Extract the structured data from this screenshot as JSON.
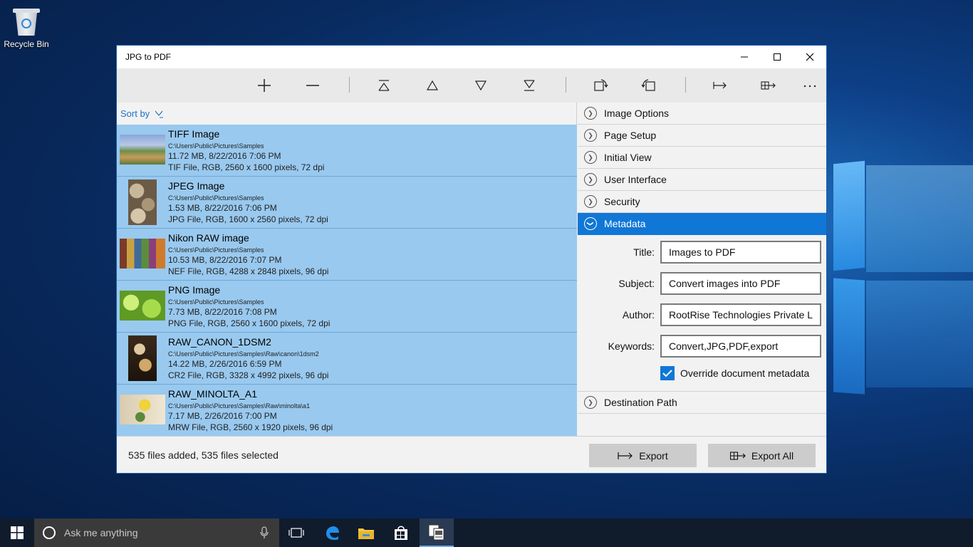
{
  "desktop": {
    "recycle_bin_label": "Recycle Bin"
  },
  "window": {
    "title": "JPG to PDF"
  },
  "toolbar": {
    "icons": [
      "add-icon",
      "remove-icon",
      "move-top-icon",
      "move-up-icon",
      "move-down-icon",
      "move-bottom-icon",
      "rotate-left-icon",
      "rotate-right-icon",
      "export-icon",
      "export-all-icon",
      "more-icon"
    ]
  },
  "sort": {
    "label": "Sort by"
  },
  "files": [
    {
      "name": "TIFF Image",
      "path": "C:\\Users\\Public\\Pictures\\Samples",
      "size": "11.72 MB, 8/22/2016 7:06 PM",
      "info": "TIF File, RGB, 2560 x 1600 pixels, 72 dpi"
    },
    {
      "name": "JPEG Image",
      "path": "C:\\Users\\Public\\Pictures\\Samples",
      "size": "1.53 MB, 8/22/2016 7:06 PM",
      "info": "JPG File, RGB, 1600 x 2560 pixels, 72 dpi"
    },
    {
      "name": "Nikon RAW image",
      "path": "C:\\Users\\Public\\Pictures\\Samples",
      "size": "10.53 MB, 8/22/2016 7:07 PM",
      "info": "NEF File, RGB, 4288 x 2848 pixels, 96 dpi"
    },
    {
      "name": "PNG Image",
      "path": "C:\\Users\\Public\\Pictures\\Samples",
      "size": "7.73 MB, 8/22/2016 7:08 PM",
      "info": "PNG File, RGB, 2560 x 1600 pixels, 72 dpi"
    },
    {
      "name": "RAW_CANON_1DSM2",
      "path": "C:\\Users\\Public\\Pictures\\Samples\\Raw\\canon\\1dsm2",
      "size": "14.22 MB, 2/26/2016 6:59 PM",
      "info": "CR2 File, RGB, 3328 x 4992 pixels, 96 dpi"
    },
    {
      "name": "RAW_MINOLTA_A1",
      "path": "C:\\Users\\Public\\Pictures\\Samples\\Raw\\minolta\\a1",
      "size": "7.17 MB, 2/26/2016 7:00 PM",
      "info": "MRW File, RGB, 2560 x 1920 pixels, 96 dpi"
    }
  ],
  "sections": {
    "image_options": "Image Options",
    "page_setup": "Page Setup",
    "initial_view": "Initial View",
    "user_interface": "User Interface",
    "security": "Security",
    "metadata": "Metadata",
    "destination_path": "Destination Path"
  },
  "metadata": {
    "title_label": "Title:",
    "title_value": "Images to PDF",
    "subject_label": "Subject:",
    "subject_value": "Convert images into PDF",
    "author_label": "Author:",
    "author_value": "RootRise Technologies Private L",
    "keywords_label": "Keywords:",
    "keywords_value": "Convert,JPG,PDF,export",
    "override_label": "Override document metadata",
    "override_checked": true
  },
  "status": {
    "text": "535 files added, 535 files selected",
    "export_label": "Export",
    "export_all_label": "Export All"
  },
  "taskbar": {
    "search_placeholder": "Ask me anything"
  },
  "colors": {
    "accent": "#1177d6",
    "selection": "#99c9ef"
  }
}
